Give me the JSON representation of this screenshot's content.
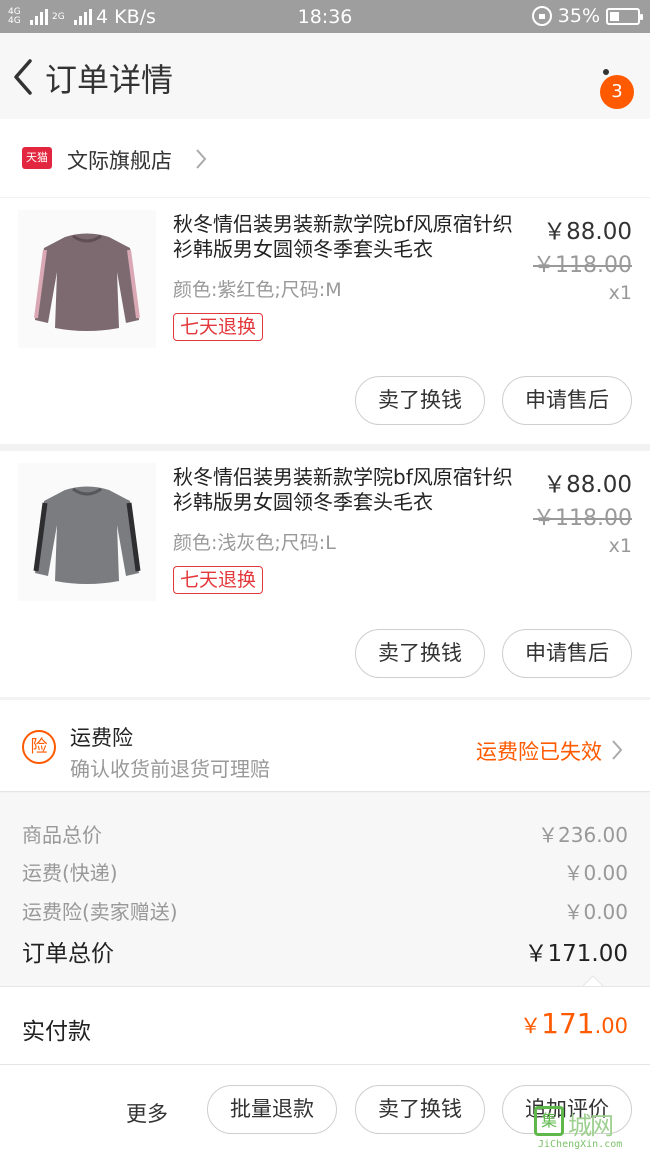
{
  "status_bar": {
    "network_left": "4G",
    "network_left2": "4G",
    "network_2g": "2G",
    "speed": "4 KB/s",
    "time": "18:36",
    "battery": "35%",
    "battery_level": 0.35
  },
  "nav": {
    "title": "订单详情",
    "badge_count": "3"
  },
  "store": {
    "badge_text": "天猫",
    "name": "文际旗舰店"
  },
  "items": [
    {
      "title": "秋冬情侣装男装新款学院bf风原宿针织衫韩版男女圆领冬季套头毛衣",
      "spec": "颜色:紫红色;尺码:M",
      "tag": "七天退换",
      "price": "￥88.00",
      "old_price": "￥118.00",
      "qty": "x1",
      "btn_sell": "卖了换钱",
      "btn_after": "申请售后",
      "sweater_color": "#7d6a70"
    },
    {
      "title": "秋冬情侣装男装新款学院bf风原宿针织衫韩版男女圆领冬季套头毛衣",
      "spec": "颜色:浅灰色;尺码:L",
      "tag": "七天退换",
      "price": "￥88.00",
      "old_price": "￥118.00",
      "qty": "x1",
      "btn_sell": "卖了换钱",
      "btn_after": "申请售后",
      "sweater_color": "#7a7c80"
    }
  ],
  "insurance": {
    "icon_text": "险",
    "title": "运费险",
    "subtitle": "确认收货前退货可理赔",
    "status": "运费险已失效"
  },
  "summary": {
    "rows": [
      {
        "label": "商品总价",
        "value": "￥236.00"
      },
      {
        "label": "运费(快递)",
        "value": "￥0.00"
      },
      {
        "label": "运费险(卖家赠送)",
        "value": "￥0.00"
      }
    ],
    "total_label": "订单总价",
    "total_value": "￥171.00"
  },
  "paid": {
    "label": "实付款",
    "currency": "￥",
    "integer": "171",
    "decimal": ".00"
  },
  "actions": {
    "more": "更多",
    "batch_refund": "批量退款",
    "sell": "卖了换钱",
    "review": "追加评价"
  },
  "watermark": {
    "box": "集",
    "cn": "城网",
    "en": "JiChengXin.com"
  },
  "colors": {
    "accent": "#ff5a00",
    "tag_red": "#e4393c",
    "tmall_red": "#e3263f"
  }
}
